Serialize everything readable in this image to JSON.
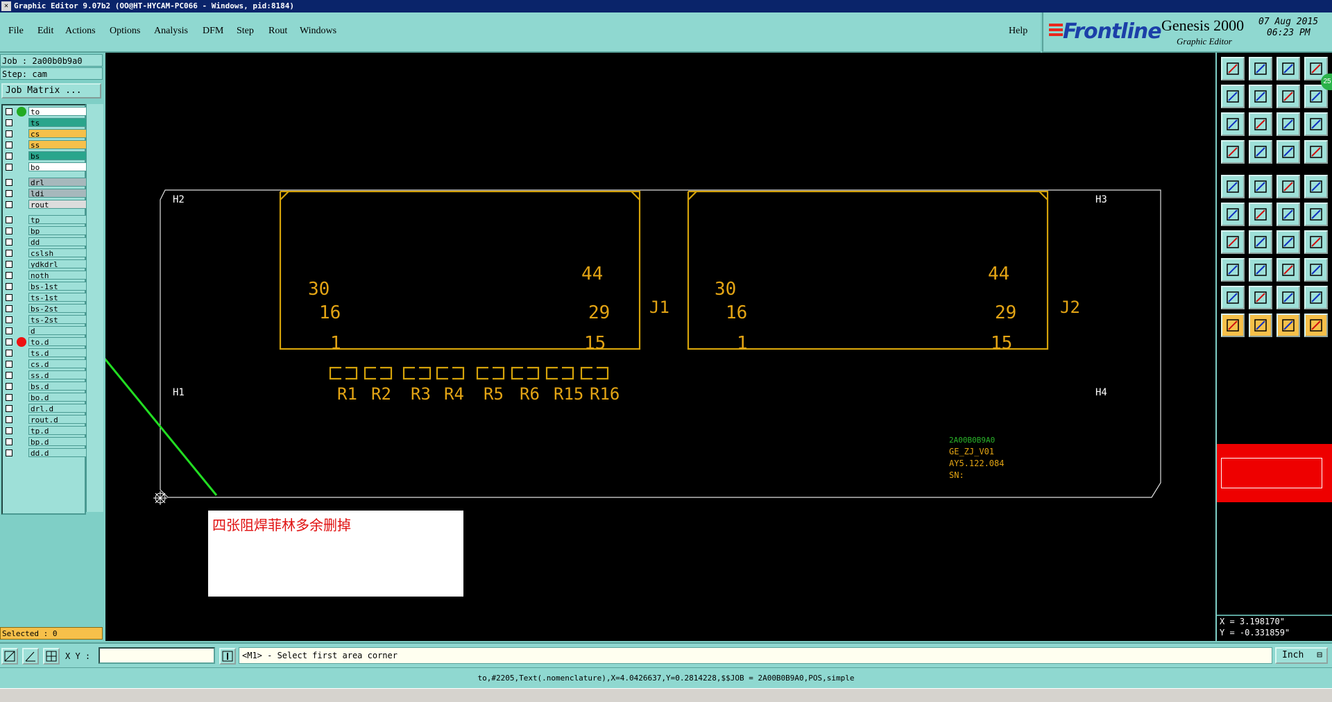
{
  "window": {
    "title": "Graphic Editor 9.07b2 (OO@HT-HYCAM-PC066 - Windows, pid:8184)"
  },
  "menu": {
    "items": [
      "File",
      "Edit",
      "Actions",
      "Options",
      "Analysis",
      "DFM",
      "Step",
      "Rout",
      "Windows"
    ],
    "help": "Help"
  },
  "brand": {
    "logo": "Frontline",
    "product": "Genesis 2000",
    "subtitle": "Graphic Editor",
    "date": "07 Aug 2015",
    "time": "06:23 PM"
  },
  "left_panel": {
    "job": "Job : 2a00b0b9a0",
    "step": "Step: cam",
    "job_matrix_button": "Job Matrix ...",
    "selected": "Selected : 0",
    "layers": [
      {
        "name": "to",
        "bg": "#ffffff",
        "dot": "#22aa22",
        "group": 0
      },
      {
        "name": "ts",
        "bg": "#2aa58c",
        "dot": "",
        "group": 0
      },
      {
        "name": "cs",
        "bg": "#f6c04a",
        "dot": "",
        "group": 0
      },
      {
        "name": "ss",
        "bg": "#f6c04a",
        "dot": "",
        "group": 0
      },
      {
        "name": "bs",
        "bg": "#2aa58c",
        "dot": "",
        "group": 0
      },
      {
        "name": "bo",
        "bg": "#ffffff",
        "dot": "",
        "group": 0
      },
      {
        "name": "drl",
        "bg": "#a6b8bc",
        "dot": "",
        "group": 1
      },
      {
        "name": "ldi",
        "bg": "#a6b8bc",
        "dot": "",
        "group": 1
      },
      {
        "name": "rout",
        "bg": "#dcdcdc",
        "dot": "",
        "group": 1
      },
      {
        "name": "tp",
        "bg": "#9ee0d8",
        "dot": "",
        "group": 2
      },
      {
        "name": "bp",
        "bg": "#9ee0d8",
        "dot": "",
        "group": 2
      },
      {
        "name": "dd",
        "bg": "#9ee0d8",
        "dot": "",
        "group": 2
      },
      {
        "name": "cslsh",
        "bg": "#9ee0d8",
        "dot": "",
        "group": 2
      },
      {
        "name": "ydkdrl",
        "bg": "#9ee0d8",
        "dot": "",
        "group": 2
      },
      {
        "name": "noth",
        "bg": "#9ee0d8",
        "dot": "",
        "group": 2
      },
      {
        "name": "bs-1st",
        "bg": "#9ee0d8",
        "dot": "",
        "group": 2
      },
      {
        "name": "ts-1st",
        "bg": "#9ee0d8",
        "dot": "",
        "group": 2
      },
      {
        "name": "bs-2st",
        "bg": "#9ee0d8",
        "dot": "",
        "group": 2
      },
      {
        "name": "ts-2st",
        "bg": "#9ee0d8",
        "dot": "",
        "group": 2
      },
      {
        "name": "d",
        "bg": "#9ee0d8",
        "dot": "",
        "group": 2
      },
      {
        "name": "to.d",
        "bg": "#9ee0d8",
        "dot": "#ee1111",
        "group": 2
      },
      {
        "name": "ts.d",
        "bg": "#9ee0d8",
        "dot": "",
        "group": 2
      },
      {
        "name": "cs.d",
        "bg": "#9ee0d8",
        "dot": "",
        "group": 2
      },
      {
        "name": "ss.d",
        "bg": "#9ee0d8",
        "dot": "",
        "group": 2
      },
      {
        "name": "bs.d",
        "bg": "#9ee0d8",
        "dot": "",
        "group": 2
      },
      {
        "name": "bo.d",
        "bg": "#9ee0d8",
        "dot": "",
        "group": 2
      },
      {
        "name": "drl.d",
        "bg": "#9ee0d8",
        "dot": "",
        "group": 2
      },
      {
        "name": "rout.d",
        "bg": "#9ee0d8",
        "dot": "",
        "group": 2
      },
      {
        "name": "tp.d",
        "bg": "#9ee0d8",
        "dot": "",
        "group": 2
      },
      {
        "name": "bp.d",
        "bg": "#9ee0d8",
        "dot": "",
        "group": 2
      },
      {
        "name": "dd.d",
        "bg": "#9ee0d8",
        "dot": "",
        "group": 2
      }
    ]
  },
  "canvas": {
    "board_color": "#e0e0e0",
    "connector_color": "#d4a20a",
    "text_color": "#e3a414",
    "corner_labels": {
      "tl": "H2",
      "tr": "H3",
      "bl": "H1",
      "br": "H4"
    },
    "connectors": [
      {
        "ref": "J1",
        "pins": {
          "p30": "30",
          "p16": "16",
          "p1": "1",
          "p44": "44",
          "p29": "29",
          "p15": "15"
        }
      },
      {
        "ref": "J2",
        "pins": {
          "p30": "30",
          "p16": "16",
          "p1": "1",
          "p44": "44",
          "p29": "29",
          "p15": "15"
        }
      }
    ],
    "resistors": [
      "R1",
      "R2",
      "R3",
      "R4",
      "R5",
      "R6",
      "R15",
      "R16"
    ],
    "info_text": {
      "line1": "2A00B0B9A0",
      "line2": "GE_ZJ_V01",
      "line3": "AY5.122.084",
      "line4": "SN:"
    },
    "annotation": "四张阻焊菲林多余删掉",
    "annotation_color": "#e01010",
    "arrow_color": "#22dd22"
  },
  "right_toolbar": {
    "coord_x": "X = 3.198170\"",
    "coord_y": "Y = -0.331859\"",
    "badge": "25",
    "highlight_color": "#ee0000"
  },
  "command_bar": {
    "xy_label": "X Y :",
    "xy_value": "",
    "prompt": "<M1> - Select first area corner",
    "units": "Inch"
  },
  "status_bar": {
    "text": "to,#2205,Text(.nomenclature),X=4.0426637,Y=0.2814228,$$JOB = 2A00B0B9A0,POS,simple"
  }
}
